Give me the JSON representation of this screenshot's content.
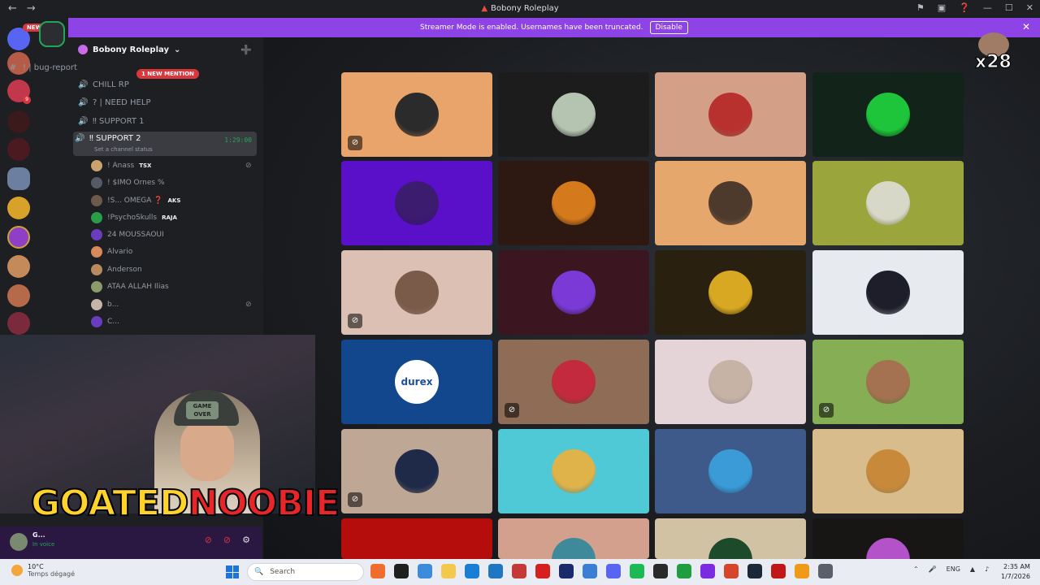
{
  "window": {
    "title": "Bobony Roleplay",
    "back_icon": "arrow-left",
    "forward_icon": "arrow-right",
    "controls": [
      "inbox-icon",
      "monitor-icon",
      "help-icon",
      "minimize-icon",
      "maximize-icon",
      "close-icon"
    ]
  },
  "banner": {
    "text": "Streamer Mode is enabled. Usernames have been truncated.",
    "disable_label": "Disable"
  },
  "rail": {
    "new_label": "NEW"
  },
  "server": {
    "name": "Bobony Roleplay",
    "new_mention_label": "1 NEW MENTION"
  },
  "channels": [
    {
      "name": "! | bug-report"
    },
    {
      "name": "CHILL RP"
    },
    {
      "name": "? | NEED HELP"
    },
    {
      "name": "‼ SUPPORT 1"
    },
    {
      "name": "‼ SUPPORT 2",
      "timer": "1:29:00",
      "status": "Set a channel status"
    }
  ],
  "members": [
    {
      "name": "! Anass",
      "role": "TSX",
      "color": "#c9a36b"
    },
    {
      "name": "! $IMO Ornes %",
      "role": "",
      "color": "#555b66"
    },
    {
      "name": "!S... OMEGA ❓",
      "role": "AKS",
      "color": "#6e5a4a"
    },
    {
      "name": "!PsychoSkulls",
      "role": "RAJA",
      "color": "#2a9d4a"
    },
    {
      "name": "24 MOUSSAOUI",
      "role": "",
      "color": "#6a3dbf"
    },
    {
      "name": "Alvario",
      "role": "",
      "color": "#d88a5a"
    },
    {
      "name": "Anderson",
      "role": "",
      "color": "#b98a5e"
    },
    {
      "name": "ATAA ALLAH Ilias",
      "role": "",
      "color": "#8b9b6a"
    },
    {
      "name": "b...",
      "role": "",
      "color": "#c5b6a8"
    },
    {
      "name": "C...",
      "role": "",
      "color": "#6a3dbf"
    }
  ],
  "overlay": {
    "brand_a": "GOATED",
    "brand_b": "NOOBIE",
    "cap_badge": "GAME OVER",
    "multiplier": "x28"
  },
  "user_panel": {
    "name": "G...",
    "status": "In voice"
  },
  "tiles": [
    {
      "bg": "#e9a46b",
      "pic": "#2b2b2b",
      "muted": true
    },
    {
      "bg": "#1c1c1c",
      "pic": "#b5c4b0",
      "muted": false
    },
    {
      "bg": "#d39f86",
      "pic": "#b8312f",
      "muted": false
    },
    {
      "bg": "#12231a",
      "pic": "#1ec43a",
      "muted": false
    },
    {
      "bg": "#5a0fc8",
      "pic": "#3b1c6e",
      "muted": false
    },
    {
      "bg": "#2e1812",
      "pic": "#d47a1d",
      "muted": false
    },
    {
      "bg": "#e5a76c",
      "pic": "#4d3a2c",
      "muted": false
    },
    {
      "bg": "#9aa53b",
      "pic": "#d8d8c8",
      "muted": false
    },
    {
      "bg": "#dcc0b4",
      "pic": "#7a5a48",
      "muted": true
    },
    {
      "bg": "#3b1620",
      "pic": "#7b3ad6",
      "muted": false
    },
    {
      "bg": "#2a2010",
      "pic": "#d9a822",
      "muted": false
    },
    {
      "bg": "#e7eaef",
      "pic": "#1d1e2a",
      "muted": false
    },
    {
      "bg": "#12478d",
      "pic": "#ffffff",
      "muted": false,
      "label": "durex"
    },
    {
      "bg": "#8e6c56",
      "pic": "#c42a3e",
      "muted": true
    },
    {
      "bg": "#e4d3d7",
      "pic": "#c7b3a6",
      "muted": false
    },
    {
      "bg": "#86ae54",
      "pic": "#a47250",
      "muted": true
    },
    {
      "bg": "#bfa795",
      "pic": "#1f2a48",
      "muted": true
    },
    {
      "bg": "#4fc9d5",
      "pic": "#e0b24a",
      "muted": false
    },
    {
      "bg": "#3e5a8a",
      "pic": "#3a9bd7",
      "muted": false
    },
    {
      "bg": "#d9bc8c",
      "pic": "#c88a3a",
      "muted": false
    },
    {
      "bg": "#b50c0c",
      "pic": "#b50c0c",
      "muted": false
    },
    {
      "bg": "#d2a08c",
      "pic": "#3e8a9a",
      "muted": false
    },
    {
      "bg": "#d2c2a4",
      "pic": "#1c4a2a",
      "muted": false
    },
    {
      "bg": "#171615",
      "pic": "#b453c9",
      "muted": false
    }
  ],
  "taskbar": {
    "temperature": "10°C",
    "weather": "Temps dégagé",
    "search_placeholder": "Search",
    "language": "ENG",
    "time": "2:35 AM",
    "date": "1/7/2026",
    "apps": [
      "#f06d2d",
      "#1f1f1f",
      "#3c8cd9",
      "#f2c94c",
      "#1a7fd4",
      "#1f76c2",
      "#c43838",
      "#d61f1f",
      "#1b2a6b",
      "#3a7fd4",
      "#5865f2",
      "#1db954",
      "#2a2a2a",
      "#1e9e3e",
      "#7b2be0",
      "#d5452a",
      "#1b2838",
      "#c01818",
      "#f09a1a",
      "#5a5f6a"
    ]
  }
}
